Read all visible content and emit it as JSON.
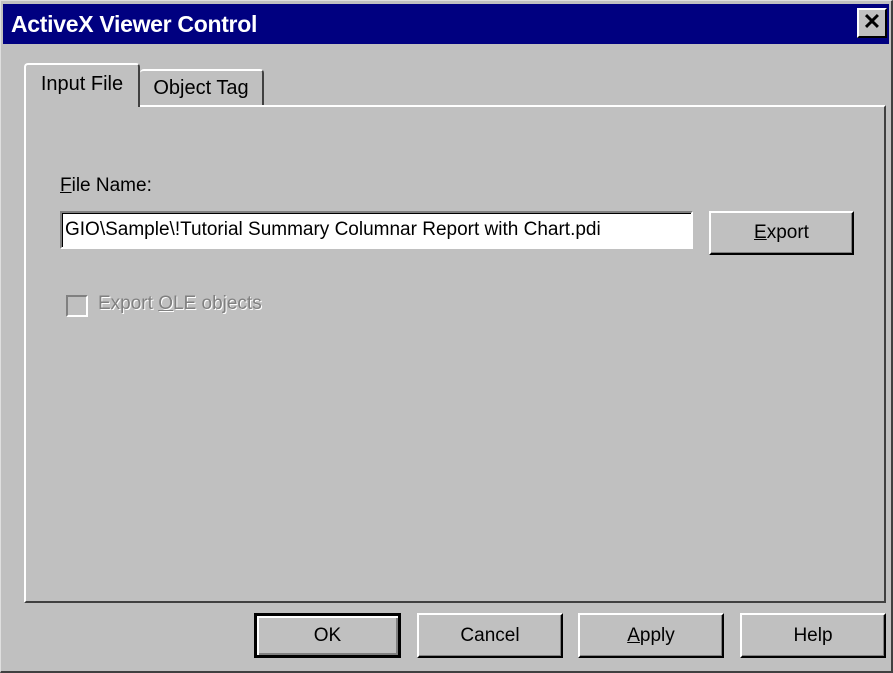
{
  "window": {
    "title": "ActiveX Viewer Control",
    "close_glyph": "✕"
  },
  "tabs": [
    {
      "label": "Input File",
      "active": true
    },
    {
      "label": "Object Tag",
      "active": false
    }
  ],
  "input_file": {
    "file_name_label_accel": "F",
    "file_name_label_rest": "ile Name:",
    "file_name_value": "GIO\\Sample\\!Tutorial Summary Columnar Report with Chart.pdi",
    "export_button_accel": "E",
    "export_button_rest": "xport",
    "export_ole_pre": "Export ",
    "export_ole_accel": "O",
    "export_ole_post": "LE objects",
    "export_ole_checked": false,
    "export_ole_enabled": false
  },
  "buttons": {
    "ok": "OK",
    "cancel": "Cancel",
    "apply_accel": "A",
    "apply_rest": "pply",
    "help": "Help"
  },
  "colors": {
    "titlebar": "#000080",
    "face": "#c0c0c0",
    "disabled_text": "#808080"
  }
}
